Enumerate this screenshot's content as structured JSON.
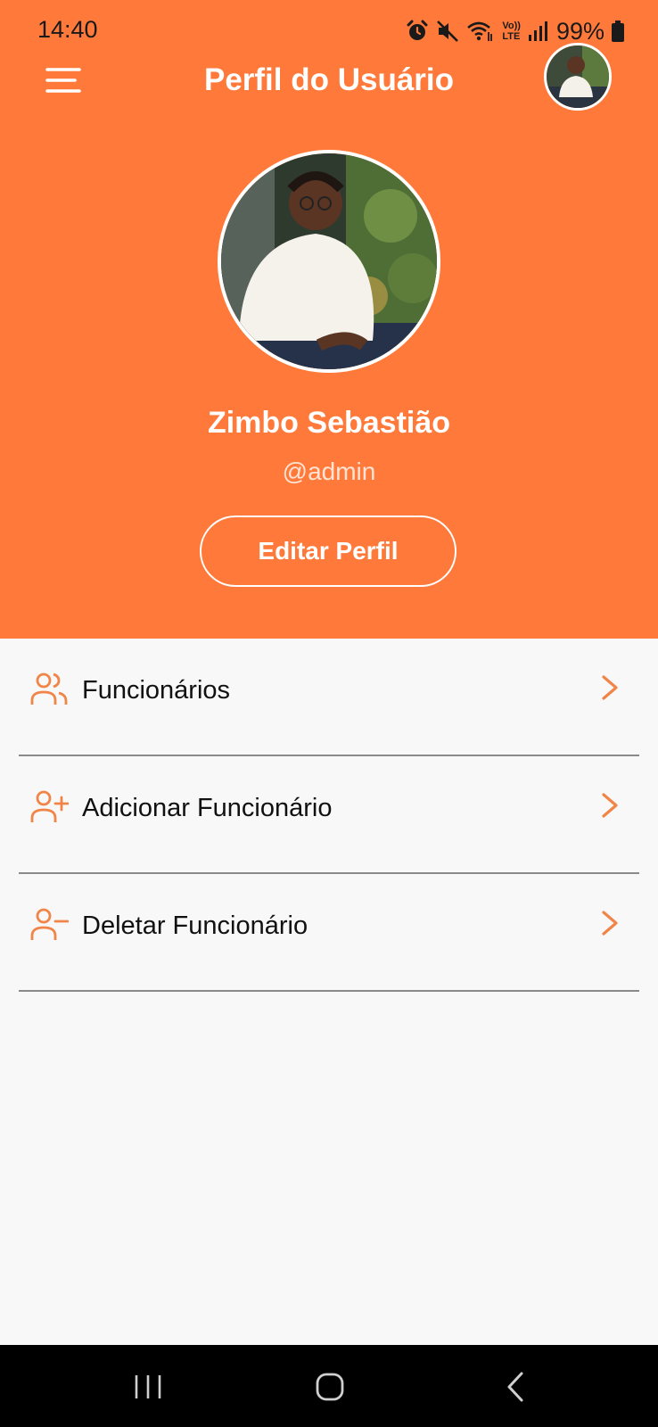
{
  "status_bar": {
    "time": "14:40",
    "battery": "99%",
    "icons": [
      "alarm-icon",
      "mute-icon",
      "wifi-icon",
      "volte-icon",
      "signal-icon",
      "battery-icon"
    ],
    "volte_top": "Vo))",
    "volte_bottom": "LTE"
  },
  "header": {
    "title": "Perfil do Usuário",
    "background_color": "#ff7a3a"
  },
  "profile": {
    "name": "Zimbo Sebastião",
    "handle": "@admin",
    "edit_button": "Editar Perfil"
  },
  "menu": {
    "items": [
      {
        "label": "Funcionários",
        "icon": "users-icon"
      },
      {
        "label": "Adicionar Funcionário",
        "icon": "user-plus-icon"
      },
      {
        "label": "Deletar Funcionário",
        "icon": "user-minus-icon"
      }
    ],
    "accent_color": "#f08547"
  },
  "nav_bar": {
    "buttons": [
      "recents-icon",
      "home-icon",
      "back-icon"
    ]
  }
}
